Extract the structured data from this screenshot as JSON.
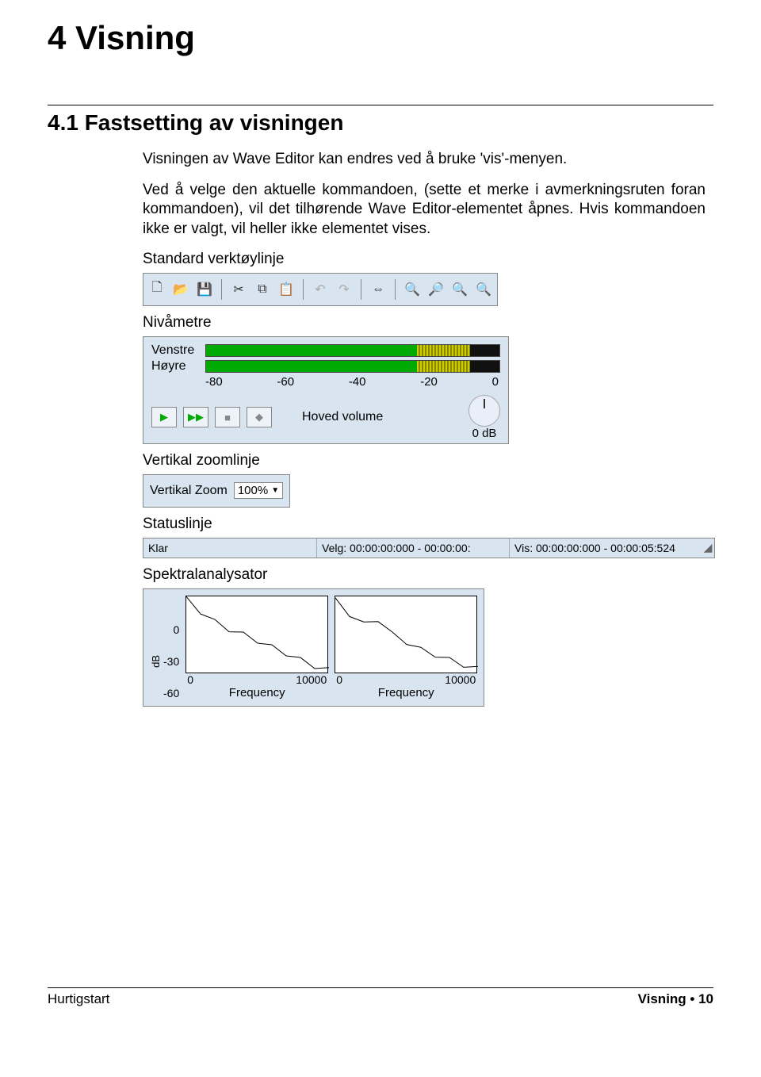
{
  "heading": "4   Visning",
  "section_title": "4.1   Fastsetting av visningen",
  "para1": "Visningen av Wave Editor kan endres ved å bruke 'vis'-menyen.",
  "para2": "Ved å velge den aktuelle kommandoen, (sette et merke i avmerkningsruten foran kommandoen), vil det tilhørende Wave Editor-elementet åpnes. Hvis kommandoen ikke er valgt, vil heller ikke elementet vises.",
  "captions": {
    "toolbar": "Standard verktøylinje",
    "meters": "Nivåmetre",
    "vzoom": "Vertikal zoomlinje",
    "status": "Statuslinje",
    "spectral": "Spektralanalysator"
  },
  "meters": {
    "left_label": "Venstre",
    "right_label": "Høyre",
    "scale": [
      "-80",
      "-60",
      "-40",
      "-20",
      "0"
    ],
    "volume_label": "Hoved volume",
    "knob_db": "0 dB"
  },
  "vzoom": {
    "label": "Vertikal Zoom",
    "value": "100%"
  },
  "status": {
    "ready": "Klar",
    "sel": "Velg: 00:00:00:000 - 00:00:00:",
    "vis": "Vis: 00:00:00:000 - 00:00:05:524"
  },
  "spectral": {
    "yticks": [
      "0",
      "-30",
      "-60"
    ],
    "yunit": "dB",
    "xticks": [
      "0",
      "10000"
    ],
    "xlabel": "Frequency"
  },
  "footer": {
    "left": "Hurtigstart",
    "right": "Visning  •  10"
  },
  "chart_data": [
    {
      "type": "line",
      "title": "Spectral (left channel)",
      "xlabel": "Frequency",
      "ylabel": "dB",
      "xlim": [
        0,
        10000
      ],
      "ylim": [
        -60,
        0
      ],
      "x": [
        0,
        1000,
        2000,
        3000,
        4000,
        5000,
        6000,
        7000,
        8000,
        9000,
        10000
      ],
      "values": [
        -2,
        -12,
        -20,
        -26,
        -30,
        -35,
        -40,
        -45,
        -50,
        -55,
        -58
      ]
    },
    {
      "type": "line",
      "title": "Spectral (right channel)",
      "xlabel": "Frequency",
      "ylabel": "dB",
      "xlim": [
        0,
        10000
      ],
      "ylim": [
        -60,
        0
      ],
      "x": [
        0,
        1000,
        2000,
        3000,
        4000,
        5000,
        6000,
        7000,
        8000,
        9000,
        10000
      ],
      "values": [
        -3,
        -14,
        -22,
        -18,
        -30,
        -36,
        -42,
        -46,
        -50,
        -54,
        -57
      ]
    }
  ]
}
